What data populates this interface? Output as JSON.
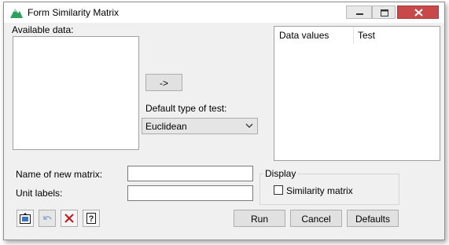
{
  "window": {
    "title": "Form Similarity Matrix"
  },
  "available_data": {
    "label": "Available data:",
    "items": []
  },
  "transfer_button": {
    "label": "->"
  },
  "default_test": {
    "label": "Default type of test:",
    "selected": "Euclidean"
  },
  "data_grid": {
    "columns": [
      "Data values",
      "Test"
    ],
    "rows": []
  },
  "new_matrix": {
    "label": "Name of new matrix:",
    "value": ""
  },
  "unit_labels": {
    "label": "Unit labels:",
    "value": ""
  },
  "display": {
    "title": "Display",
    "similarity_matrix_label": "Similarity matrix",
    "similarity_matrix_checked": false
  },
  "actions": {
    "run": "Run",
    "cancel": "Cancel",
    "defaults": "Defaults"
  },
  "toolbar_icons": [
    "pin-to-spreadsheet-icon",
    "undo-icon",
    "clear-icon",
    "help-icon"
  ],
  "colors": {
    "close_button": "#c7494a",
    "title_icon_green": "#2e9f5c",
    "undo_blue": "#8fa6d6",
    "clear_red": "#c01818"
  }
}
